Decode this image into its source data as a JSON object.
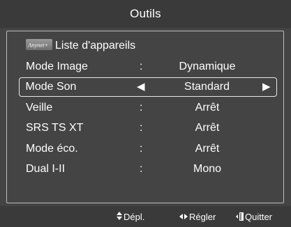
{
  "menu": {
    "title": "Outils",
    "anynet_logo_text": "Anynet+",
    "items": [
      {
        "label": "Liste d'appareils",
        "separator": "",
        "value": "",
        "icon": "anynet-logo"
      },
      {
        "label": "Mode Image",
        "separator": ":",
        "value": "Dynamique"
      },
      {
        "label": "Mode Son",
        "separator": "",
        "value": "Standard",
        "selected": true,
        "left_arrow": "◀",
        "right_arrow": "▶"
      },
      {
        "label": "Veille",
        "separator": ":",
        "value": "Arrêt"
      },
      {
        "label": "SRS TS XT",
        "separator": ":",
        "value": "Arrêt"
      },
      {
        "label": "Mode éco.",
        "separator": ":",
        "value": "Arrêt"
      },
      {
        "label": "Dual I-II",
        "separator": ":",
        "value": "Mono"
      }
    ]
  },
  "footer": {
    "move_icon": "up-down-arrow-icon",
    "move_label": "Dépl.",
    "adjust_icon": "left-right-arrow-icon",
    "adjust_label": "Régler",
    "exit_icon": "exit-door-icon",
    "exit_label": "Quitter"
  },
  "colors": {
    "title_bar": "#3a3a3a",
    "menu_body": "#444444",
    "text": "#ffffff",
    "panel_border": "#bdbdbd",
    "selection_border": "#e8e8e8"
  }
}
